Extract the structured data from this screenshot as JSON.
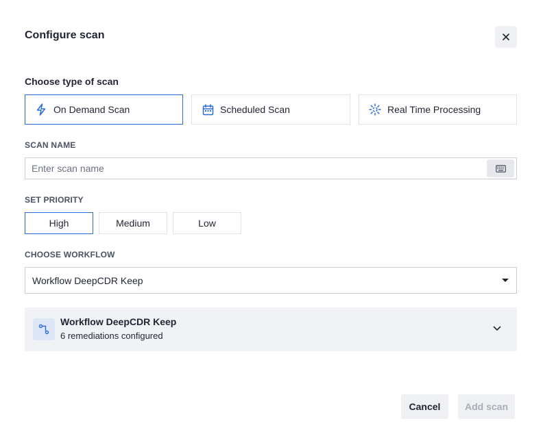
{
  "dialog": {
    "title": "Configure scan",
    "close_icon": "close-icon"
  },
  "scan_type": {
    "heading": "Choose type of scan",
    "options": [
      {
        "label": "On Demand Scan",
        "icon": "lightning-icon",
        "selected": true
      },
      {
        "label": "Scheduled Scan",
        "icon": "calendar-icon",
        "selected": false
      },
      {
        "label": "Real Time Processing",
        "icon": "spinner-icon",
        "selected": false
      }
    ]
  },
  "scan_name": {
    "label": "SCAN NAME",
    "value": "",
    "placeholder": "Enter scan name",
    "keyboard_icon": "keyboard-icon"
  },
  "priority": {
    "label": "SET PRIORITY",
    "options": [
      {
        "label": "High",
        "selected": true
      },
      {
        "label": "Medium",
        "selected": false
      },
      {
        "label": "Low",
        "selected": false
      }
    ]
  },
  "workflow": {
    "label": "CHOOSE WORKFLOW",
    "selected": "Workflow DeepCDR Keep",
    "card": {
      "title": "Workflow DeepCDR Keep",
      "subtitle": "6 remediations configured",
      "icon": "workflow-icon"
    }
  },
  "actions": {
    "cancel_label": "Cancel",
    "add_label": "Add scan",
    "add_disabled": true
  },
  "colors": {
    "accent": "#2a6ad9",
    "border": "#dfe2e7",
    "card_bg": "#f1f2f6",
    "disabled_text": "#a9adb5"
  }
}
